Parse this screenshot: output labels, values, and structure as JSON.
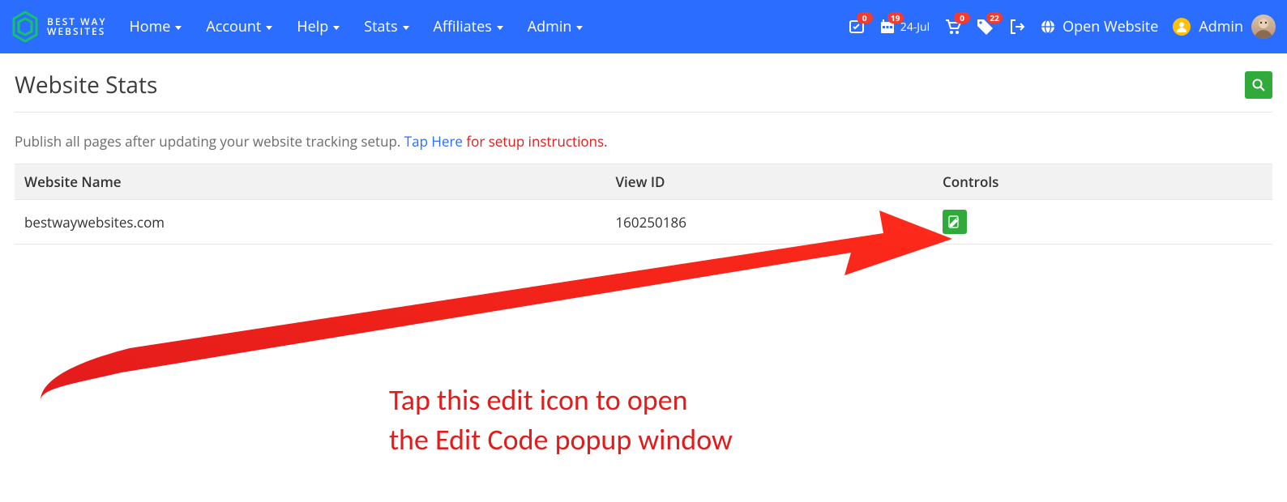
{
  "brand": {
    "line1": "BEST WAY",
    "line2": "WEBSITES"
  },
  "nav": {
    "items": [
      {
        "label": "Home"
      },
      {
        "label": "Account"
      },
      {
        "label": "Help"
      },
      {
        "label": "Stats"
      },
      {
        "label": "Affiliates"
      },
      {
        "label": "Admin"
      }
    ]
  },
  "nav_right": {
    "tasks_badge": "0",
    "calendar_badge": "19",
    "calendar_date": "24-Jul",
    "cart_badge": "0",
    "tags_badge": "22",
    "open_website": "Open Website",
    "admin_label": "Admin"
  },
  "page": {
    "title": "Website Stats",
    "intro_prefix": "Publish all pages after updating your website tracking setup. ",
    "intro_link": "Tap Here",
    "intro_suffix": " for setup instructions."
  },
  "table": {
    "headers": {
      "name": "Website Name",
      "view_id": "View ID",
      "controls": "Controls"
    },
    "rows": [
      {
        "name": "bestwaywebsites.com",
        "view_id": "160250186"
      }
    ]
  },
  "annotation": {
    "line1": "Tap this edit icon to open",
    "line2": "the Edit Code popup window"
  }
}
